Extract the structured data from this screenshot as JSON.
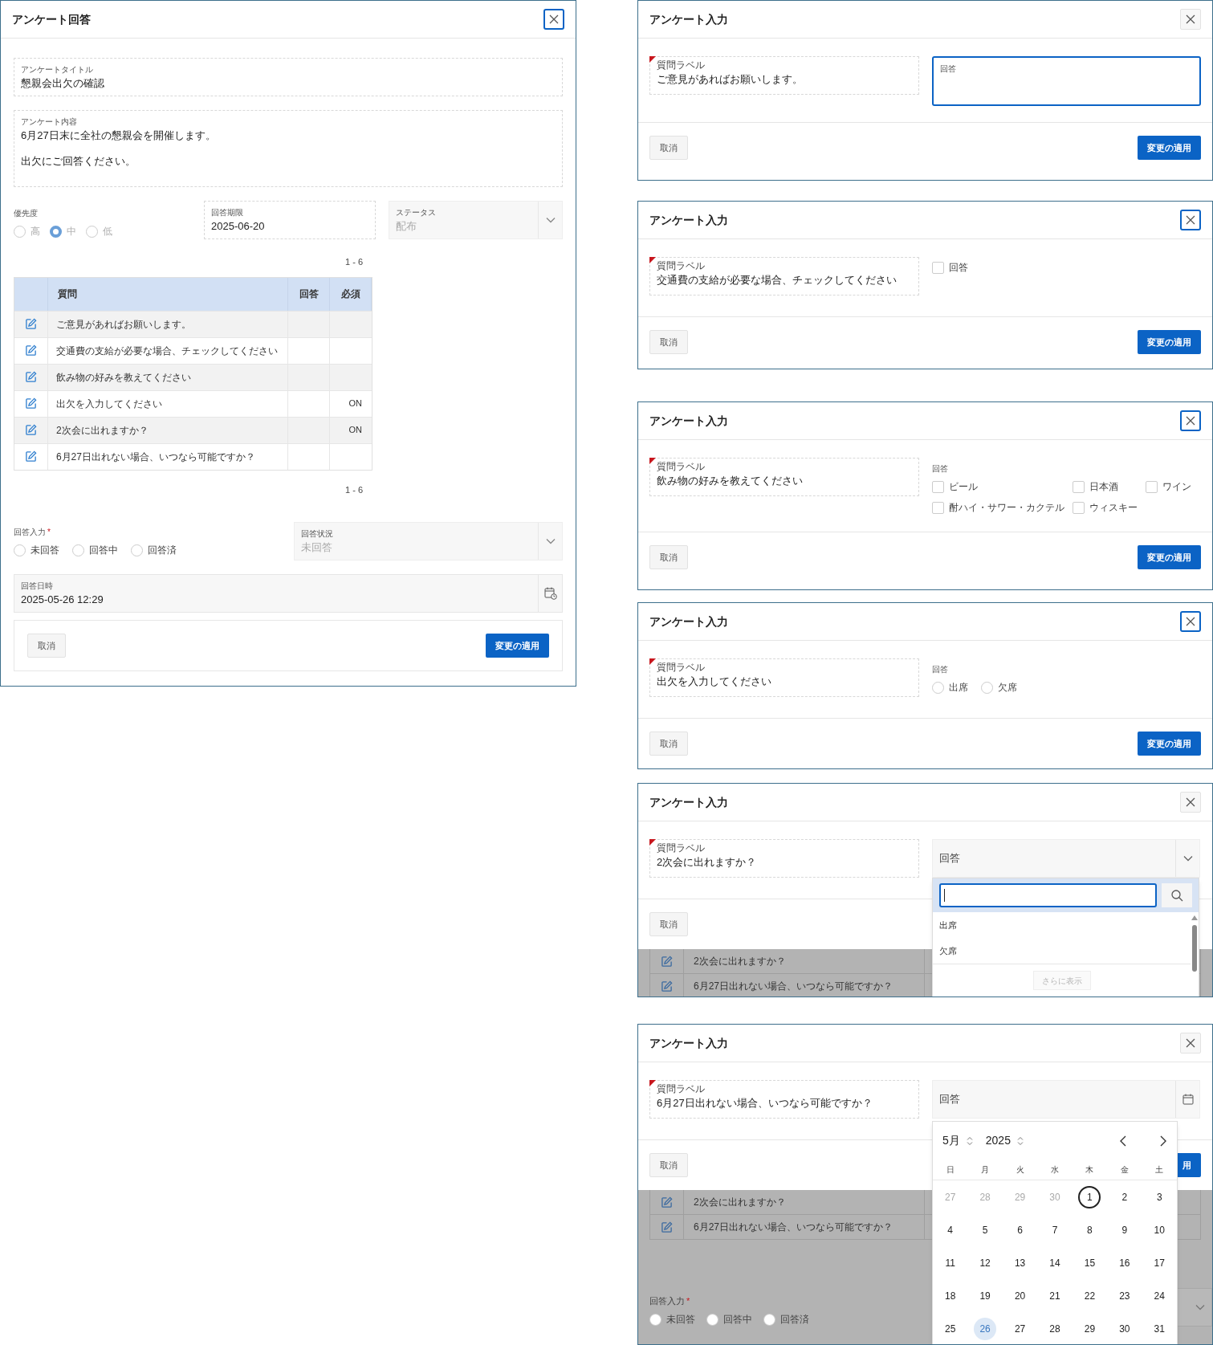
{
  "main_dialog": {
    "title": "アンケート回答",
    "close_focused": true,
    "survey_title": {
      "label": "アンケートタイトル",
      "value": "懇親会出欠の確認"
    },
    "survey_content": {
      "label": "アンケート内容",
      "lines": [
        "6月27日末に全社の懇親会を開催します。",
        "出欠にご回答ください。"
      ]
    },
    "priority": {
      "label": "優先度",
      "disabled": true,
      "options": [
        {
          "label": "高",
          "selected": false
        },
        {
          "label": "中",
          "selected": true
        },
        {
          "label": "低",
          "selected": false
        }
      ]
    },
    "deadline": {
      "label": "回答期限",
      "value": "2025-06-20"
    },
    "status": {
      "label": "ステータス",
      "value": "配布"
    },
    "pager_top": "1 - 6",
    "table": {
      "columns": [
        "質問",
        "回答",
        "必須"
      ],
      "rows": [
        {
          "question": "ご意見があればお願いします。"
        },
        {
          "question": "交通費の支給が必要な場合、チェックしてください"
        },
        {
          "question": "飲み物の好みを教えてください"
        },
        {
          "question": "出欠を入力してください",
          "required": "ON"
        },
        {
          "question": "2次会に出れますか？",
          "required": "ON"
        },
        {
          "question": "6月27日出れない場合、いつなら可能ですか？"
        }
      ]
    },
    "pager_bottom": "1 - 6",
    "answer_input": {
      "label": "回答入力",
      "required_mark": "*",
      "options": [
        {
          "label": "未回答",
          "selected": false
        },
        {
          "label": "回答中",
          "selected": false
        },
        {
          "label": "回答済",
          "selected": false
        }
      ]
    },
    "answer_status": {
      "label": "回答状況",
      "value": "未回答"
    },
    "answered_at": {
      "label": "回答日時",
      "value": "2025-05-26 12:29"
    },
    "cancel": "取消",
    "apply": "変更の適用"
  },
  "input_dialogs": [
    {
      "kind": "textarea",
      "title": "アンケート入力",
      "close_focused": false,
      "question_required": true,
      "question_label": "質問ラベル",
      "question": "ご意見があればお願いします。",
      "answer_label": "回答",
      "focused": true,
      "cancel": "取消",
      "apply": "変更の適用"
    },
    {
      "kind": "checkbox",
      "title": "アンケート入力",
      "close_focused": true,
      "question_required": true,
      "question_label": "質問ラベル",
      "question": "交通費の支給が必要な場合、チェックしてください",
      "answer_label": "回答",
      "checked": false,
      "cancel": "取消",
      "apply": "変更の適用"
    },
    {
      "kind": "checkbox_group",
      "title": "アンケート入力",
      "close_focused": true,
      "question_required": true,
      "question_label": "質問ラベル",
      "question": "飲み物の好みを教えてください",
      "answer_label": "回答",
      "options": [
        {
          "label": "ビール",
          "checked": false
        },
        {
          "label": "日本酒",
          "checked": false
        },
        {
          "label": "ワイン",
          "checked": false
        },
        {
          "label": "酎ハイ・サワー・カクテル",
          "checked": false
        },
        {
          "label": "ウィスキー",
          "checked": false
        }
      ],
      "cancel": "取消",
      "apply": "変更の適用"
    },
    {
      "kind": "radio",
      "title": "アンケート入力",
      "close_focused": true,
      "question_required": true,
      "question_label": "質問ラベル",
      "question": "出欠を入力してください",
      "answer_label": "回答",
      "options": [
        {
          "label": "出席",
          "selected": false
        },
        {
          "label": "欠席",
          "selected": false
        }
      ],
      "cancel": "取消",
      "apply": "変更の適用"
    },
    {
      "kind": "select",
      "title": "アンケート入力",
      "close_focused": false,
      "question_required": true,
      "question_label": "質問ラベル",
      "question": "2次会に出れますか？",
      "answer_placeholder": "回答",
      "cancel": "取消",
      "dropdown": {
        "options": [
          "出席",
          "欠席"
        ],
        "more": "さらに表示"
      },
      "backdrop": {
        "rows": [
          "2次会に出れますか？",
          "6月27日出れない場合、いつなら可能ですか？"
        ]
      }
    },
    {
      "kind": "date",
      "title": "アンケート入力",
      "close_focused": false,
      "question_required": true,
      "question_label": "質問ラベル",
      "question": "6月27日出れない場合、いつなら可能ですか？",
      "answer_placeholder": "回答",
      "cancel": "取消",
      "apply": "用",
      "calendar": {
        "month": "5月",
        "year": "2025",
        "weekdays": [
          "日",
          "月",
          "火",
          "水",
          "木",
          "金",
          "土"
        ],
        "days": [
          {
            "label": "27",
            "outside": true,
            "today": false,
            "selected": false
          },
          {
            "label": "28",
            "outside": true,
            "today": false,
            "selected": false
          },
          {
            "label": "29",
            "outside": true,
            "today": false,
            "selected": false
          },
          {
            "label": "30",
            "outside": true,
            "today": false,
            "selected": false
          },
          {
            "label": "1",
            "outside": false,
            "today": true,
            "selected": false
          },
          {
            "label": "2",
            "outside": false,
            "today": false,
            "selected": false
          },
          {
            "label": "3",
            "outside": false,
            "today": false,
            "selected": false
          },
          {
            "label": "4",
            "outside": false,
            "today": false,
            "selected": false
          },
          {
            "label": "5",
            "outside": false,
            "today": false,
            "selected": false
          },
          {
            "label": "6",
            "outside": false,
            "today": false,
            "selected": false
          },
          {
            "label": "7",
            "outside": false,
            "today": false,
            "selected": false
          },
          {
            "label": "8",
            "outside": false,
            "today": false,
            "selected": false
          },
          {
            "label": "9",
            "outside": false,
            "today": false,
            "selected": false
          },
          {
            "label": "10",
            "outside": false,
            "today": false,
            "selected": false
          },
          {
            "label": "11",
            "outside": false,
            "today": false,
            "selected": false
          },
          {
            "label": "12",
            "outside": false,
            "today": false,
            "selected": false
          },
          {
            "label": "13",
            "outside": false,
            "today": false,
            "selected": false
          },
          {
            "label": "14",
            "outside": false,
            "today": false,
            "selected": false
          },
          {
            "label": "15",
            "outside": false,
            "today": false,
            "selected": false
          },
          {
            "label": "16",
            "outside": false,
            "today": false,
            "selected": false
          },
          {
            "label": "17",
            "outside": false,
            "today": false,
            "selected": false
          },
          {
            "label": "18",
            "outside": false,
            "today": false,
            "selected": false
          },
          {
            "label": "19",
            "outside": false,
            "today": false,
            "selected": false
          },
          {
            "label": "20",
            "outside": false,
            "today": false,
            "selected": false
          },
          {
            "label": "21",
            "outside": false,
            "today": false,
            "selected": false
          },
          {
            "label": "22",
            "outside": false,
            "today": false,
            "selected": false
          },
          {
            "label": "23",
            "outside": false,
            "today": false,
            "selected": false
          },
          {
            "label": "24",
            "outside": false,
            "today": false,
            "selected": false
          },
          {
            "label": "25",
            "outside": false,
            "today": false,
            "selected": false
          },
          {
            "label": "26",
            "outside": false,
            "today": false,
            "selected": true
          },
          {
            "label": "27",
            "outside": false,
            "today": false,
            "selected": false
          },
          {
            "label": "28",
            "outside": false,
            "today": false,
            "selected": false
          },
          {
            "label": "29",
            "outside": false,
            "today": false,
            "selected": false
          },
          {
            "label": "30",
            "outside": false,
            "today": false,
            "selected": false
          },
          {
            "label": "31",
            "outside": false,
            "today": false,
            "selected": false
          }
        ]
      },
      "backdrop": {
        "rows": [
          "2次会に出れますか？",
          "6月27日出れない場合、いつなら可能ですか？"
        ],
        "answer_input": {
          "label": "回答入力",
          "required_mark": "*",
          "options": [
            {
              "label": "未回答",
              "selected": false
            },
            {
              "label": "回答中",
              "selected": false
            },
            {
              "label": "回答済",
              "selected": false
            }
          ]
        }
      }
    }
  ]
}
